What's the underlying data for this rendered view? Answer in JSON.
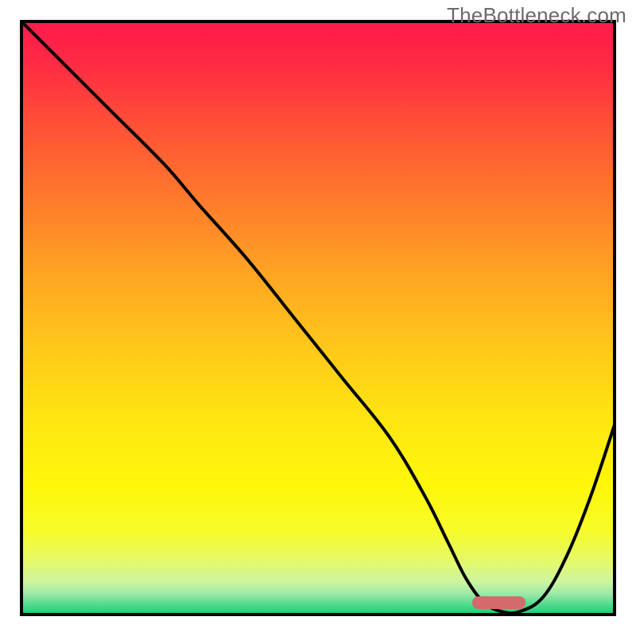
{
  "watermark": "TheBottleneck.com",
  "chart_data": {
    "type": "line",
    "title": "",
    "xlabel": "",
    "ylabel": "",
    "xlim": [
      0,
      100
    ],
    "ylim": [
      0,
      100
    ],
    "x": [
      0,
      8,
      15,
      24,
      30,
      38,
      46,
      54,
      62,
      68,
      72,
      75,
      78,
      81,
      84,
      88,
      92,
      96,
      100
    ],
    "values": [
      100,
      92,
      85,
      76,
      69,
      60,
      50,
      40,
      30,
      20,
      12,
      6,
      2,
      0.5,
      0.5,
      3,
      10,
      20,
      32
    ],
    "marker": {
      "shape": "rounded-bar",
      "x_start": 76,
      "x_end": 85,
      "y": 2,
      "color": "#d46a6a"
    },
    "background_gradient": {
      "stops": [
        {
          "offset": 0.0,
          "color": "#ff1a4b"
        },
        {
          "offset": 0.07,
          "color": "#ff2a44"
        },
        {
          "offset": 0.18,
          "color": "#ff5236"
        },
        {
          "offset": 0.3,
          "color": "#ff7a2c"
        },
        {
          "offset": 0.42,
          "color": "#ffa323"
        },
        {
          "offset": 0.54,
          "color": "#ffc51a"
        },
        {
          "offset": 0.66,
          "color": "#ffe312"
        },
        {
          "offset": 0.78,
          "color": "#fff70a"
        },
        {
          "offset": 0.86,
          "color": "#f6fb2a"
        },
        {
          "offset": 0.91,
          "color": "#e4f96a"
        },
        {
          "offset": 0.945,
          "color": "#cdf4a0"
        },
        {
          "offset": 0.965,
          "color": "#9de9a7"
        },
        {
          "offset": 0.985,
          "color": "#49d88a"
        },
        {
          "offset": 1.0,
          "color": "#16cf76"
        }
      ]
    },
    "frame": {
      "color": "#000000",
      "width": 4,
      "inset_left": 27,
      "inset_right": 27,
      "inset_top": 27,
      "inset_bottom": 27
    }
  }
}
